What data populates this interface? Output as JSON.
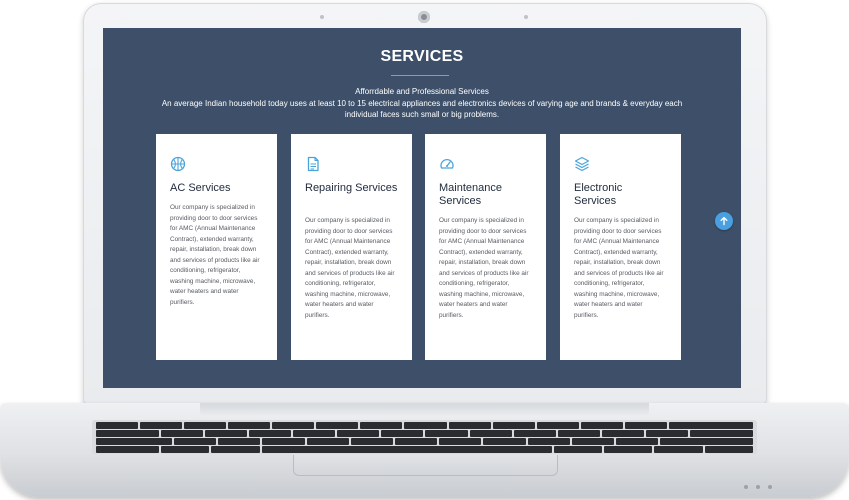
{
  "section": {
    "title": "SERVICES",
    "subtitle": "Afforrdable and Professional Services",
    "intro": "An average Indian household today uses at least 10 to 15 electrical appliances and electronics devices of varying age and brands & everyday each individual faces such small or big problems."
  },
  "cards": [
    {
      "icon": "basketball-icon",
      "title": "AC Services",
      "body": "Our company is specialized in providing door to door services for AMC (Annual Maintenance Contract), extended warranty, repair, installation, break down and services of products like air conditioning, refrigerator, washing machine, microwave, water heaters and water purifiers."
    },
    {
      "icon": "document-icon",
      "title": "Repairing Services",
      "body": "Our company is specialized in providing door to door services for AMC (Annual Maintenance Contract), extended warranty, repair, installation, break down and services of products like air conditioning, refrigerator, washing machine, microwave, water heaters and water purifiers."
    },
    {
      "icon": "gauge-icon",
      "title": "Maintenance Services",
      "body": "Our company is specialized in providing door to door services for AMC (Annual Maintenance Contract), extended warranty, repair, installation, break down and services of products like air conditioning, refrigerator, washing machine, microwave, water heaters and water purifiers."
    },
    {
      "icon": "layers-icon",
      "title": "Electronic Services",
      "body": "Our company is specialized in providing door to door services for AMC (Annual Maintenance Contract), extended warranty, repair, installation, break down and services of products like air conditioning, refrigerator, washing machine, microwave, water heaters and water purifiers."
    }
  ],
  "scroll_top": {
    "icon": "arrow-up-icon"
  },
  "colors": {
    "screen_background": "#3e5069",
    "accent": "#4a9fe0",
    "icon": "#4aa3d8",
    "card_background": "#ffffff"
  }
}
